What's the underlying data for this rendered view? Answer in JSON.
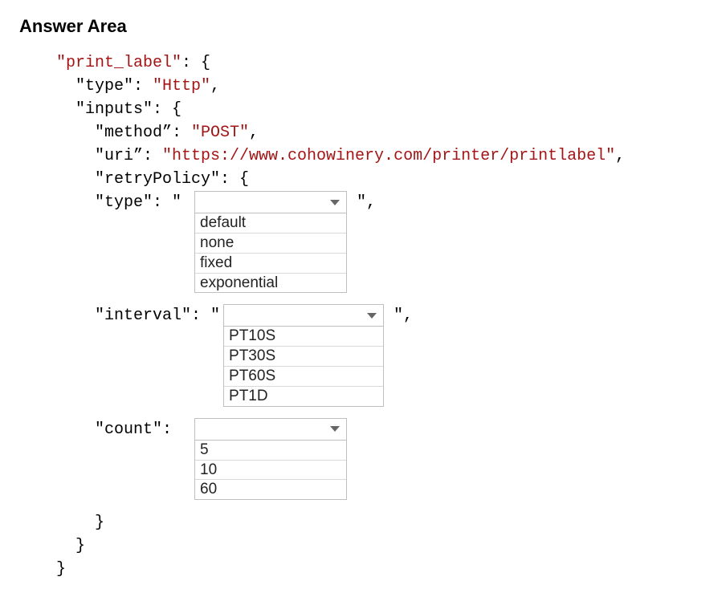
{
  "title": "Answer Area",
  "code": {
    "line1_key": "\"print_label\"",
    "line1_colon_brace": ": {",
    "line2": "\"type\": ",
    "line2_val": "\"Http\"",
    "line2_comma": ",",
    "line3": "\"inputs\": {",
    "line4_key": "\"method”: ",
    "line4_val": "\"POST\"",
    "line4_comma": ",",
    "line5_key": "\"uri”: ",
    "line5_val": "\"https://www.cohowinery.com/printer/printlabel\"",
    "line5_comma": ",",
    "line6": "\"retryPolicy\": {",
    "line7_key": "\"type\": \" ",
    "line7_after": " \",",
    "line8_key": "\"interval\": \"",
    "line8_after": " \",",
    "line9_key": "\"count\":",
    "brace1": "}",
    "brace2": "}",
    "brace3": "}"
  },
  "dropdowns": {
    "type": {
      "selected": "",
      "options": [
        "default",
        "none",
        "fixed",
        "exponential"
      ]
    },
    "interval": {
      "selected": "",
      "options": [
        "PT10S",
        "PT30S",
        "PT60S",
        "PT1D"
      ]
    },
    "count": {
      "selected": "",
      "options": [
        "5",
        "10",
        "60"
      ]
    }
  }
}
